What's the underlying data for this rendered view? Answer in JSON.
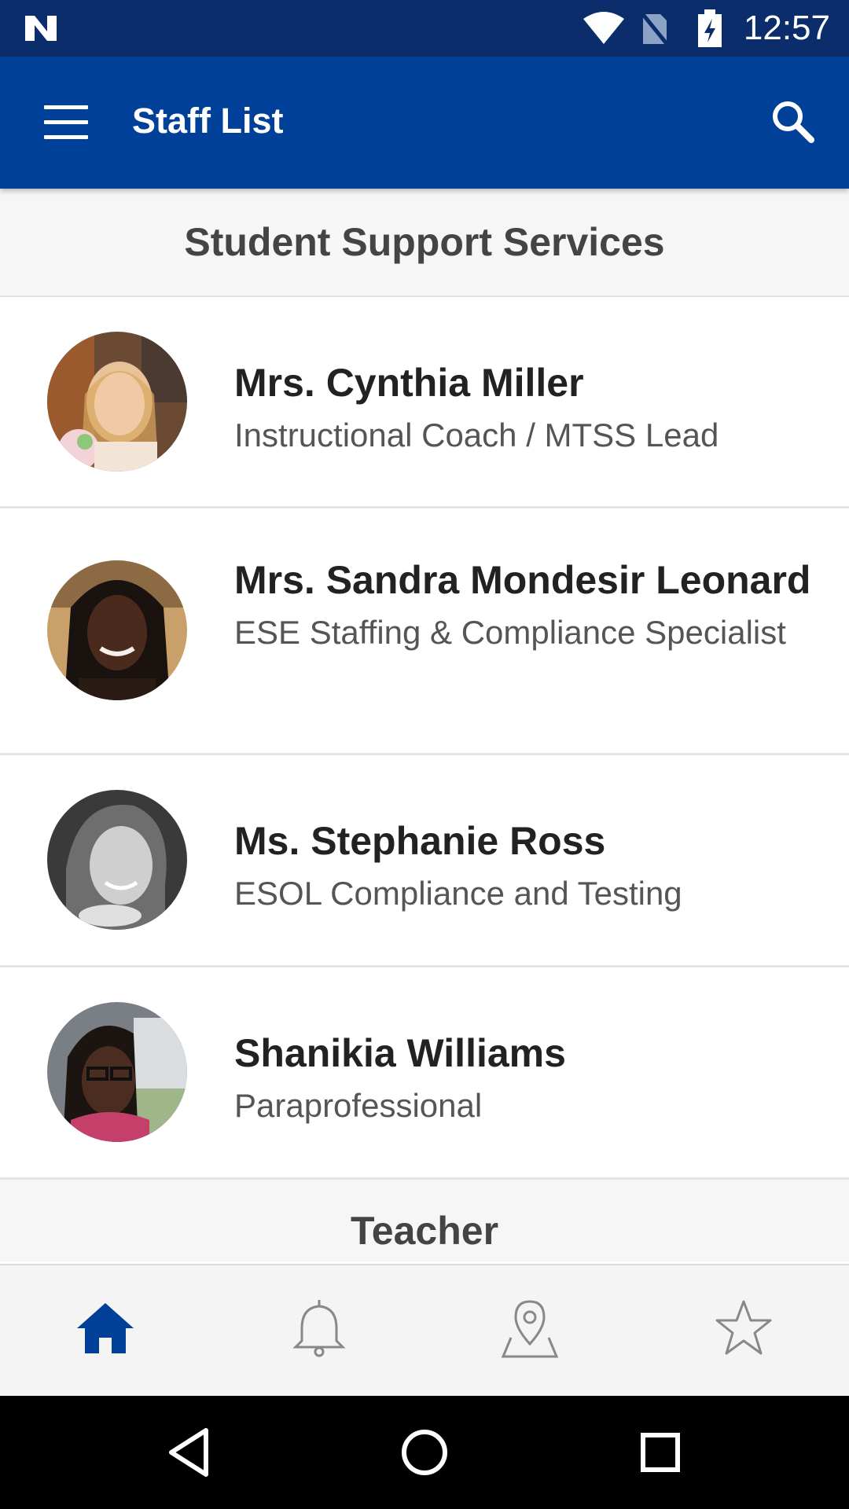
{
  "status_bar": {
    "time": "12:57",
    "icons": [
      "n-logo-icon",
      "wifi-icon",
      "no-sim-icon",
      "battery-charging-icon"
    ]
  },
  "app_bar": {
    "title": "Staff List",
    "menu_icon": "hamburger-menu-icon",
    "search_icon": "search-icon"
  },
  "sections": [
    {
      "header": "Student Support Services",
      "staff": [
        {
          "name": "Mrs. Cynthia Miller",
          "title": "Instructional Coach / MTSS Lead"
        },
        {
          "name": "Mrs. Sandra Mondesir Leonard",
          "title": "ESE Staffing & Compliance Specialist"
        },
        {
          "name": "Ms. Stephanie Ross",
          "title": "ESOL Compliance and Testing"
        },
        {
          "name": "Shanikia Williams",
          "title": "Paraprofessional"
        }
      ]
    },
    {
      "header": "Teacher",
      "staff": []
    }
  ],
  "bottom_nav": {
    "items": [
      {
        "icon": "home-icon",
        "active": true
      },
      {
        "icon": "bell-icon",
        "active": false
      },
      {
        "icon": "map-pin-icon",
        "active": false
      },
      {
        "icon": "star-icon",
        "active": false
      }
    ],
    "active_color": "#004099",
    "inactive_color": "#888888"
  },
  "system_nav": {
    "icons": [
      "back-icon",
      "home-circle-icon",
      "recents-icon"
    ]
  },
  "colors": {
    "app_bar": "#004099",
    "status_bar": "#0b2d6b"
  }
}
